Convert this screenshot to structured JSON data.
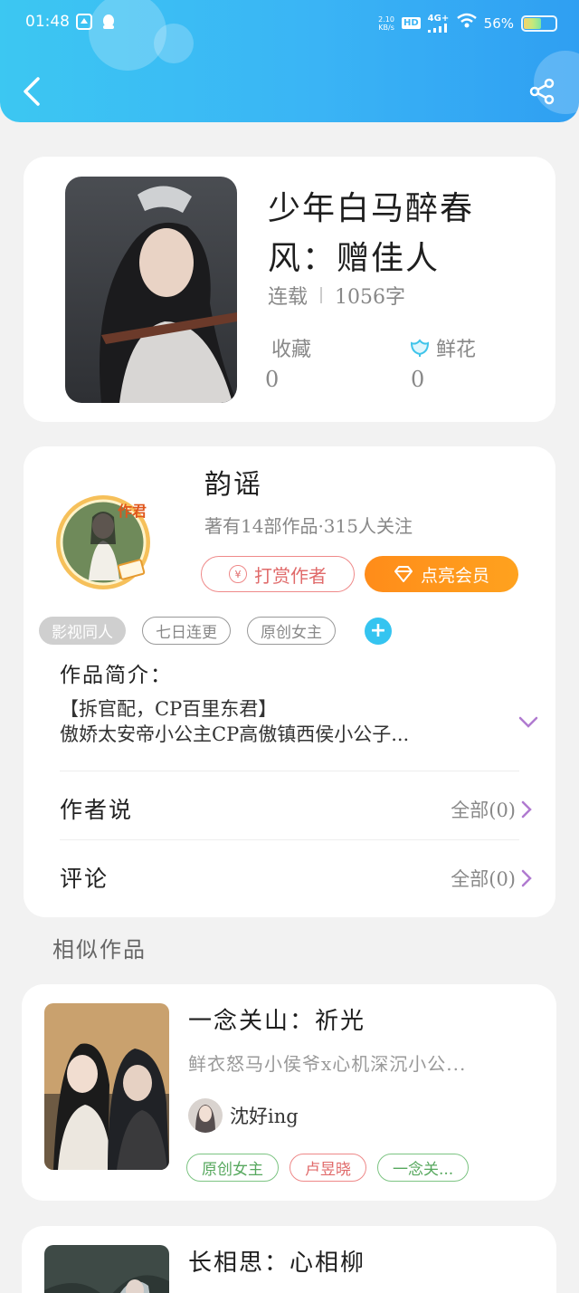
{
  "status_bar": {
    "time": "01:48",
    "net_speed_top": "2.10",
    "net_speed_bottom": "KB/s",
    "hd": "HD",
    "signal": "4G+",
    "battery": "56%",
    "battery_level": 0.56
  },
  "header": {
    "back_icon": "chevron-left-icon",
    "share_icon": "share-icon",
    "accent_color": "#3ab4f5"
  },
  "book": {
    "title_line1": "少年白马醉春",
    "title_line2": "风：赠佳人",
    "status": "连载",
    "word_count": "1056字",
    "favorites_label": "收藏",
    "favorites_value": "0",
    "flowers_label": "鲜花",
    "flowers_value": "0"
  },
  "author": {
    "badge": "作君",
    "name": "韵谣",
    "info": "著有14部作品·315人关注",
    "reward_label": "打赏作者",
    "vip_label": "点亮会员",
    "tags": [
      "影视同人",
      "七日连更",
      "原创女主"
    ],
    "intro_label": "作品简介：",
    "intro_line1": "【拆官配，CP百里东君】",
    "intro_line2": "傲娇太安帝小公主CP高傲镇西侯小公子...",
    "author_says_label": "作者说",
    "author_says_value": "全部(0)",
    "comments_label": "评论",
    "comments_value": "全部(0)"
  },
  "similar": {
    "section_title": "相似作品",
    "items": [
      {
        "title": "一念关山：祈光",
        "desc": "鲜衣怒马小侯爷x心机深沉小公...",
        "author": "沈好ing",
        "tags": [
          "原创女主",
          "卢昱晓",
          "一念关..."
        ]
      },
      {
        "title": "长相思：心相柳"
      }
    ]
  }
}
